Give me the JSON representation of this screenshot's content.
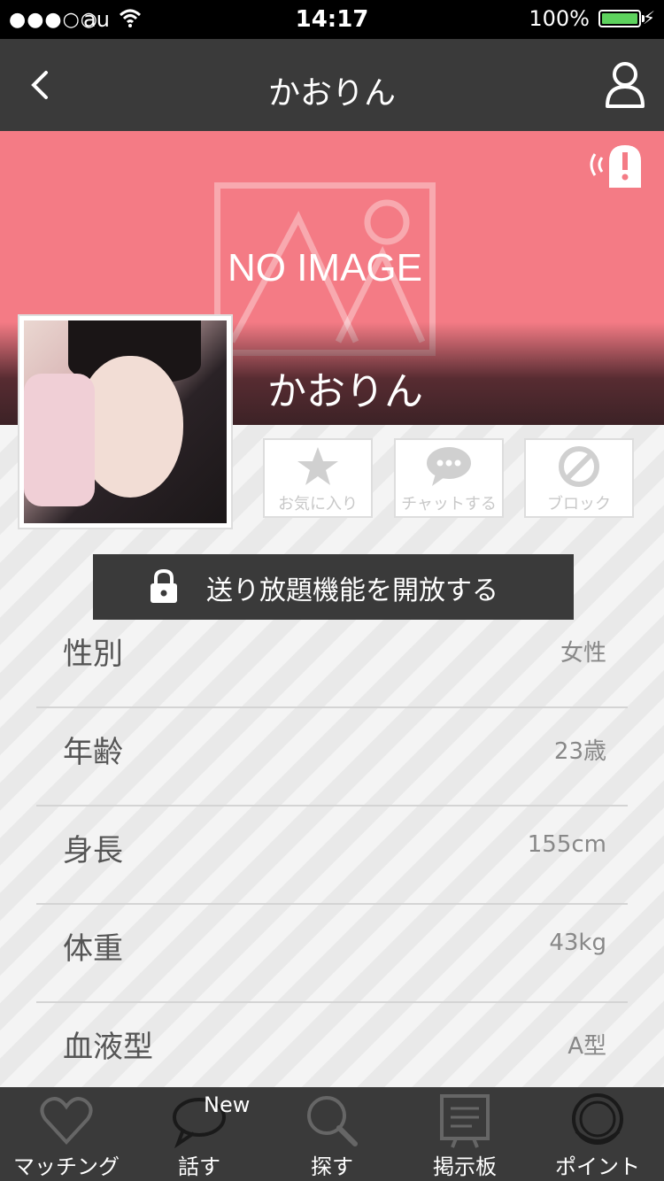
{
  "status": {
    "signal": "●●●○○",
    "carrier": "au",
    "time": "14:17",
    "battery": "100%"
  },
  "nav": {
    "title": "かおりん"
  },
  "cover": {
    "placeholder": "NO IMAGE",
    "name": "かおりん"
  },
  "actions": {
    "favorite": "お気に入り",
    "chat": "チャットする",
    "block": "ブロック"
  },
  "unlock": {
    "label": "送り放題機能を開放する"
  },
  "profile": {
    "rows": [
      {
        "key": "性別",
        "value": "女性"
      },
      {
        "key": "年齢",
        "value": "23歳"
      },
      {
        "key": "身長",
        "value": "155cm"
      },
      {
        "key": "体重",
        "value": "43kg"
      },
      {
        "key": "血液型",
        "value": "A型"
      }
    ]
  },
  "tabs": {
    "items": [
      {
        "label": "マッチング",
        "icon": "heart-icon"
      },
      {
        "label": "話す",
        "icon": "speech-bubble-icon",
        "badge": "New"
      },
      {
        "label": "探す",
        "icon": "search-icon"
      },
      {
        "label": "掲示板",
        "icon": "board-icon"
      },
      {
        "label": "ポイント",
        "icon": "coin-icon"
      }
    ]
  },
  "colors": {
    "accent": "#f47b85",
    "bar": "#3a3a3a"
  }
}
